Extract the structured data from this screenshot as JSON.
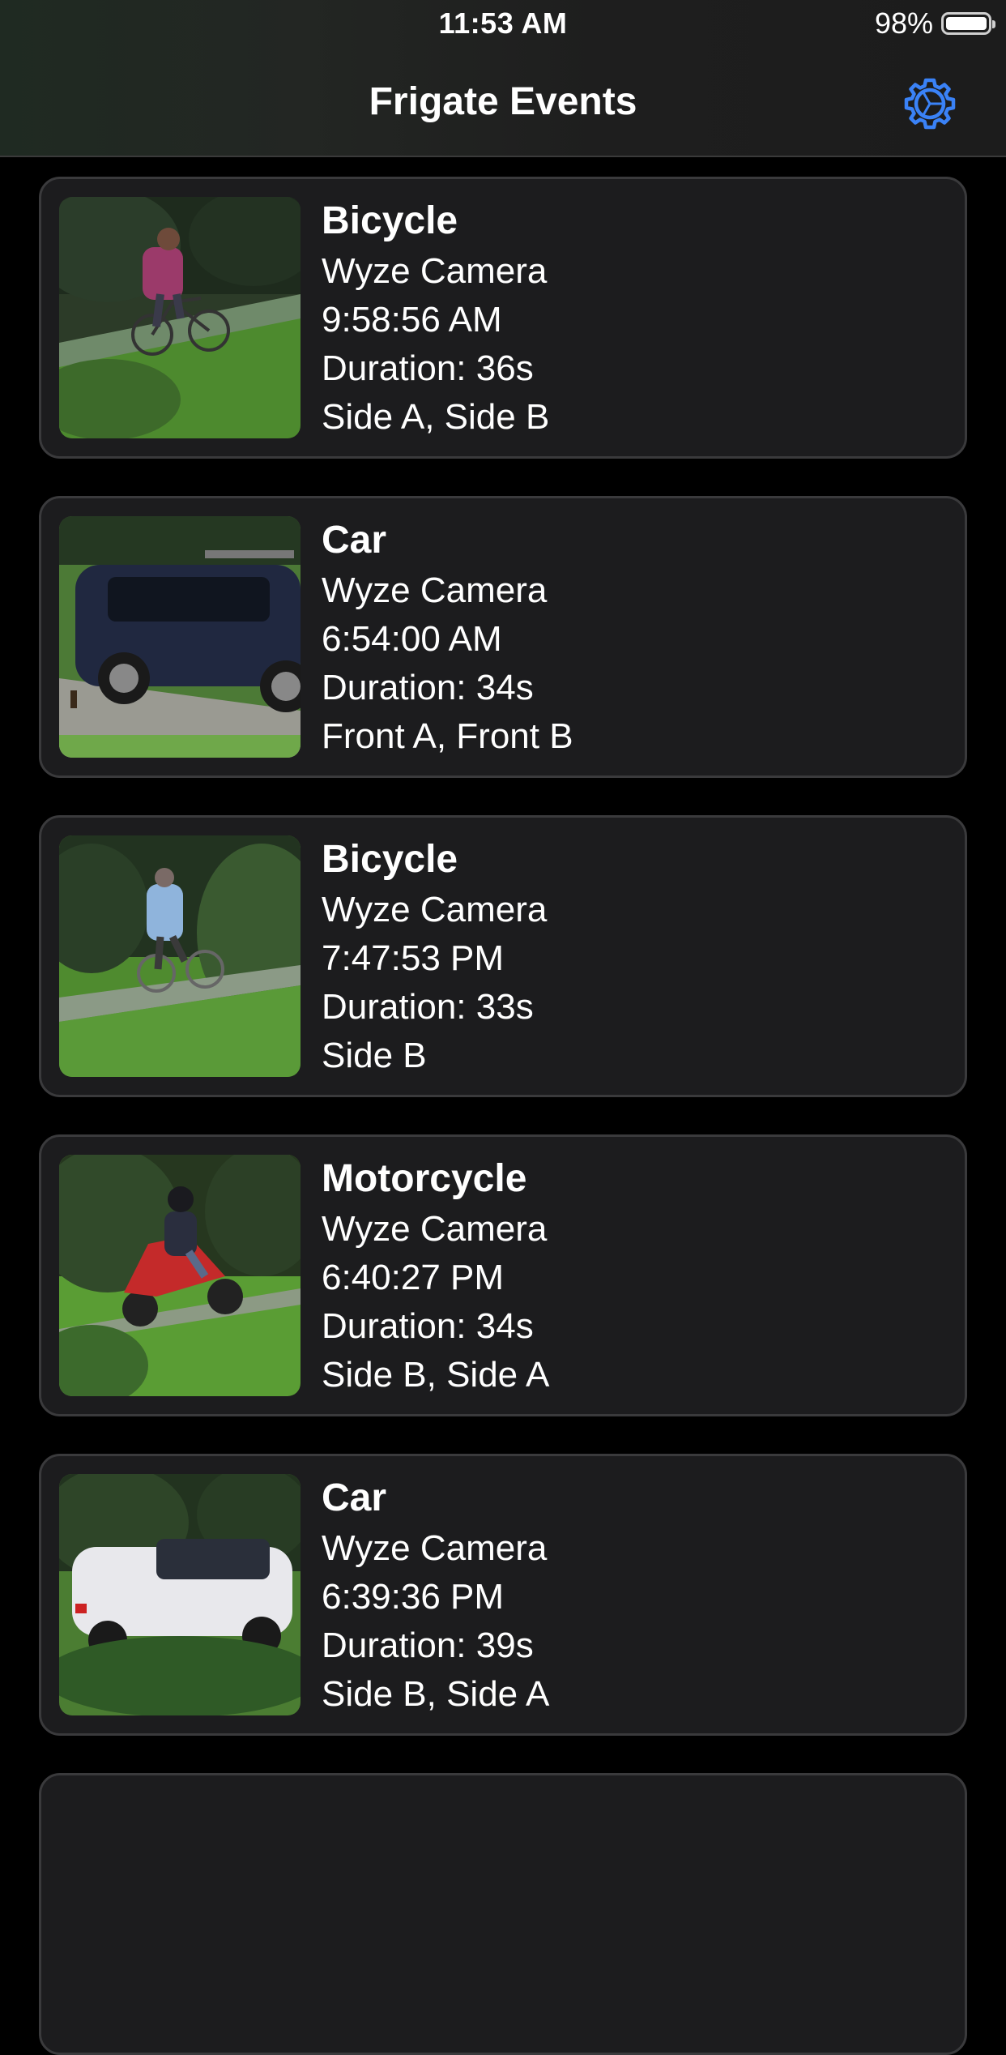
{
  "status_bar": {
    "time": "11:53 AM",
    "battery": "98%",
    "battery_level": 0.98
  },
  "nav": {
    "title": "Frigate Events",
    "settings_icon": "gear-icon",
    "accent_color": "#3a82f7"
  },
  "events": [
    {
      "label": "Bicycle",
      "camera": "Wyze Camera",
      "time": "9:58:56 AM",
      "duration": "Duration: 36s",
      "zones": "Side A, Side B"
    },
    {
      "label": "Car",
      "camera": "Wyze Camera",
      "time": "6:54:00 AM",
      "duration": "Duration: 34s",
      "zones": "Front A, Front B"
    },
    {
      "label": "Bicycle",
      "camera": "Wyze Camera",
      "time": "7:47:53 PM",
      "duration": "Duration: 33s",
      "zones": "Side B"
    },
    {
      "label": "Motorcycle",
      "camera": "Wyze Camera",
      "time": "6:40:27 PM",
      "duration": "Duration: 34s",
      "zones": "Side B, Side A"
    },
    {
      "label": "Car",
      "camera": "Wyze Camera",
      "time": "6:39:36 PM",
      "duration": "Duration: 39s",
      "zones": "Side B, Side A"
    }
  ]
}
